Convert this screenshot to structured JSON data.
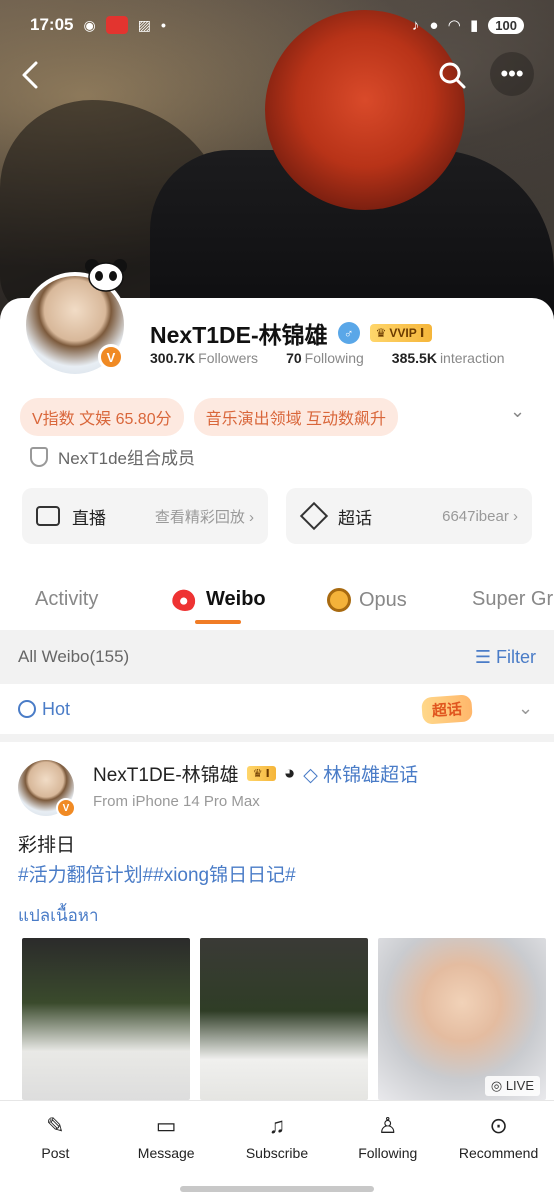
{
  "status_bar": {
    "time": "17:05",
    "battery": "100"
  },
  "profile": {
    "name": "NexT1DE-林锦雄",
    "vip_label": "VVIP Ⅰ",
    "verify_mark": "♂",
    "avatar_badge": "V",
    "stats": [
      {
        "value": "300.7K",
        "label": "Followers"
      },
      {
        "value": "70",
        "label": "Following"
      },
      {
        "value": "385.5K",
        "label": "interaction"
      }
    ],
    "tags": [
      "V指数 文娱 65.80分",
      "音乐演出领域 互动数飙升"
    ],
    "org": "NexT1de组合成员",
    "cards": [
      {
        "title": "直播",
        "sub": "查看精彩回放 ›"
      },
      {
        "title": "超话",
        "sub": "6647ibear ›"
      }
    ]
  },
  "tabs": [
    "Activity",
    "Weibo",
    "Opus",
    "Super Gr"
  ],
  "subheader": {
    "all_weibo": "All Weibo(155)",
    "filter": "Filter"
  },
  "hot": {
    "label": "Hot",
    "badge": "超话"
  },
  "post": {
    "author": "NexT1DE-林锦雄",
    "crown": "Ⅰ",
    "chaohua": "林锦雄超话",
    "source": "From iPhone 14 Pro Max",
    "text": "彩排日",
    "hashtags": "#活力翻倍计划##xiong锦日日记#",
    "translate": "แปลเนื้อหา",
    "live_label": "LIVE"
  },
  "bottom_bar": [
    {
      "label": "Post",
      "icon": "pen-icon"
    },
    {
      "label": "Message",
      "icon": "message-icon"
    },
    {
      "label": "Subscribe",
      "icon": "bell-icon"
    },
    {
      "label": "Following",
      "icon": "user-check-icon"
    },
    {
      "label": "Recommend",
      "icon": "recommend-icon"
    }
  ]
}
